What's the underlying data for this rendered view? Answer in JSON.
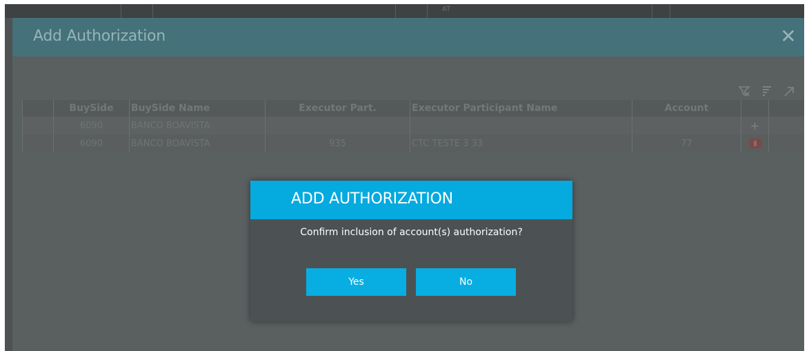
{
  "background": {
    "strip_text": "AT"
  },
  "modal": {
    "title": "Add Authorization",
    "close_glyph": "✕",
    "toolbar": {
      "icons": [
        "clear-filter-icon",
        "filter-icon",
        "expand-icon"
      ]
    }
  },
  "table": {
    "columns": [
      "BuySide",
      "BuySide Name",
      "Executor Part.",
      "Executor Participant Name",
      "Account"
    ],
    "rows": [
      {
        "buyside": "6090",
        "buyside_name": "BANCO BOAVISTA",
        "executor_part": "",
        "executor_name": "",
        "account": "",
        "action": "+"
      },
      {
        "buyside": "6090",
        "buyside_name": "BANCO BOAVISTA",
        "executor_part": "935",
        "executor_name": "CTC TESTE 3 33",
        "account": "77",
        "action": "delete"
      }
    ]
  },
  "dialog": {
    "title": "ADD AUTHORIZATION",
    "message": "Confirm inclusion of account(s) authorization?",
    "yes_label": "Yes",
    "no_label": "No"
  },
  "colors": {
    "dialog_accent": "#05aade",
    "modal_header": "#44717a",
    "overlay_bg": "#5a5f60",
    "delete_red": "#7a4a48"
  }
}
